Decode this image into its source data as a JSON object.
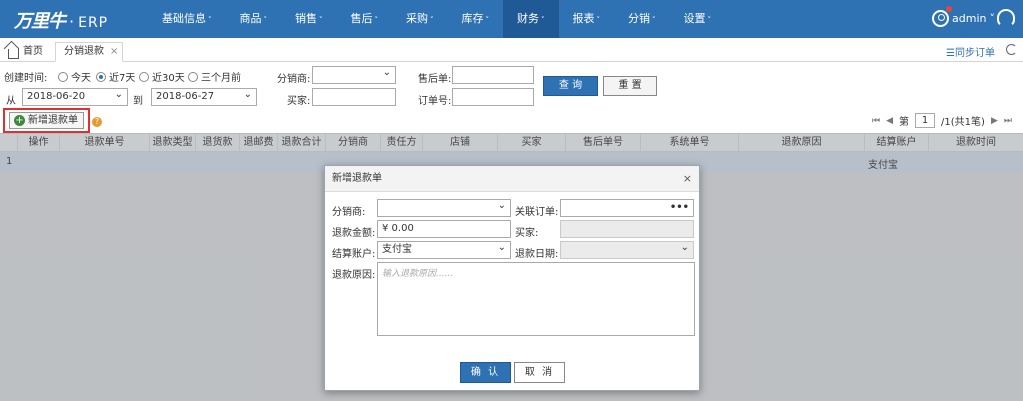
{
  "app": {
    "logo_text": "万里牛",
    "logo_dot": "·",
    "logo_erp": "ERP",
    "user": "admin",
    "nav": [
      {
        "label": "基础信息",
        "caret": "˅"
      },
      {
        "label": "商品",
        "caret": "˅"
      },
      {
        "label": "销售",
        "caret": "˅"
      },
      {
        "label": "售后",
        "caret": "˅"
      },
      {
        "label": "采购",
        "caret": "˅"
      },
      {
        "label": "库存",
        "caret": "˅"
      },
      {
        "label": "财务",
        "caret": "˅"
      },
      {
        "label": "报表",
        "caret": "˅"
      },
      {
        "label": "分销",
        "caret": "˅"
      },
      {
        "label": "设置",
        "caret": "˅"
      }
    ],
    "user_caret": "˅",
    "accent": "#2f72b3"
  },
  "tabs": {
    "home": "首页",
    "current": "分销退款",
    "close": "×",
    "sync": "☰同步订单"
  },
  "filter": {
    "created_label": "创建时间:",
    "radios": [
      "今天",
      "近7天",
      "近30天",
      "三个月前"
    ],
    "from_label": "从",
    "from_value": "2018-06-20",
    "to_label": "到",
    "to_value": "2018-06-27",
    "distributor_label": "分销商:",
    "buyer_label": "买家:",
    "aftersale_label": "售后单:",
    "order_label": "订单号:",
    "query_btn": "查 询",
    "reset_btn": "重 置"
  },
  "toolbar": {
    "add_btn": "新增退款单",
    "add_plus": "+",
    "help": "?"
  },
  "pager": {
    "first": "⏮",
    "prev": "◀",
    "page_label": "第",
    "page": "1",
    "total": "/1(共1笔)",
    "next": "▶",
    "last": "⏭"
  },
  "grid": {
    "columns": [
      "",
      "操作",
      "退款单号",
      "退款类型",
      "退货款",
      "退邮费",
      "退款合计",
      "分销商",
      "责任方",
      "店铺",
      "买家",
      "售后单号",
      "系统单号",
      "退款原因",
      "结算账户",
      "退款时间"
    ],
    "row_number": "1",
    "row_account": "支付宝"
  },
  "modal": {
    "title": "新增退款单",
    "close": "×",
    "distributor_label": "分销商:",
    "related_order_label": "关联订单:",
    "related_order_btn": "•••",
    "amount_label": "退款金额:",
    "amount_value": "¥ 0.00",
    "buyer_label": "买家:",
    "account_label": "结算账户:",
    "account_value": "支付宝",
    "date_label": "退款日期:",
    "reason_label": "退款原因:",
    "reason_placeholder": "输入退款原因......",
    "ok_btn": "确 认",
    "cancel_btn": "取 消"
  }
}
